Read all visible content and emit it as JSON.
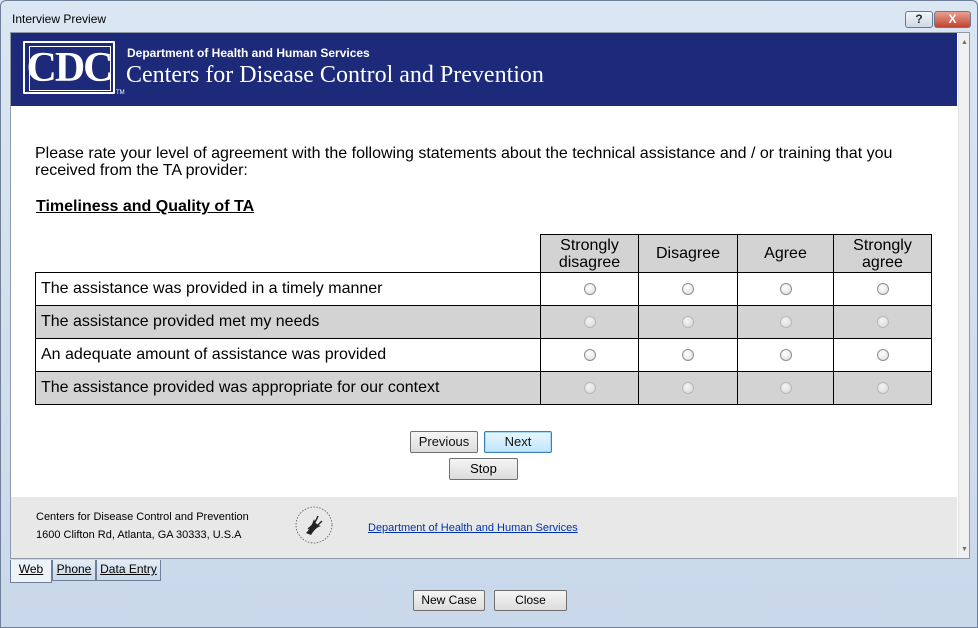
{
  "window": {
    "title": "Interview Preview",
    "help_label": "?",
    "close_label": "X"
  },
  "banner": {
    "logo_text": "CDC",
    "trademark": "TM",
    "department": "Department of Health and Human Services",
    "agency": "Centers for Disease Control and Prevention"
  },
  "survey": {
    "instructions": "Please rate your level of agreement with the following statements about the technical assistance and / or training that you received from the TA provider:",
    "section_title": "Timeliness and Quality of TA",
    "columns": [
      "Strongly disagree",
      "Disagree",
      "Agree",
      "Strongly agree"
    ],
    "statements": [
      "The assistance was provided in a timely manner",
      "The assistance provided met my needs",
      "An adequate amount of assistance was provided",
      "The assistance provided was appropriate for our context"
    ]
  },
  "nav": {
    "previous": "Previous",
    "next": "Next",
    "stop": "Stop"
  },
  "footer": {
    "org_name": "Centers for Disease Control and Prevention",
    "address": "1600 Clifton Rd, Atlanta, GA 30333, U.S.A",
    "link": "Department of Health and Human Services"
  },
  "tabs": {
    "web": "Web",
    "phone": "Phone",
    "data_entry": "Data Entry"
  },
  "bottom": {
    "new_case": "New Case",
    "close": "Close"
  },
  "colors": {
    "banner": "#1d2a79",
    "shaded_row": "#d3d3d3",
    "link": "#0033aa"
  }
}
